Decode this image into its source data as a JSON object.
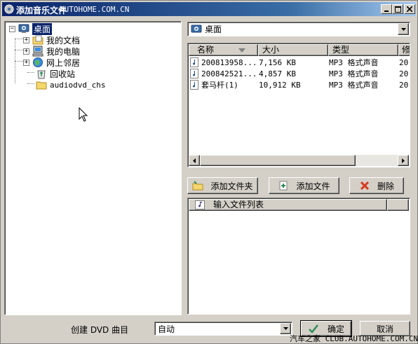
{
  "window": {
    "title": "添加音乐文件",
    "watermark": "AUTOHOME.COM.CN"
  },
  "tree": {
    "items": [
      {
        "label": "桌面",
        "icon": "desktop-icon",
        "expander": "−"
      },
      {
        "label": "我的文档",
        "icon": "my-documents-icon",
        "expander": "+"
      },
      {
        "label": "我的电脑",
        "icon": "my-computer-icon",
        "expander": "+"
      },
      {
        "label": "网上邻居",
        "icon": "network-icon",
        "expander": "+"
      },
      {
        "label": "回收站",
        "icon": "recycle-bin-icon"
      },
      {
        "label": "audiodvd_chs",
        "icon": "folder-icon"
      }
    ]
  },
  "location": {
    "value": "桌面"
  },
  "file_list": {
    "columns": [
      "名称",
      "大小",
      "类型",
      "修"
    ],
    "rows": [
      {
        "name": "200813958...",
        "size": "7,156 KB",
        "type": "MP3 格式声音",
        "extra": "20"
      },
      {
        "name": "200842521...",
        "size": "4,857 KB",
        "type": "MP3 格式声音",
        "extra": "20"
      },
      {
        "name": "套马杆(1)",
        "size": "10,912 KB",
        "type": "MP3 格式声音",
        "extra": "20"
      }
    ]
  },
  "actions": {
    "add_folder": "添加文件夹",
    "add_file": "添加文件",
    "delete": "删除"
  },
  "input_list": {
    "header": "输入文件列表"
  },
  "bottom": {
    "create_label": "创建 DVD 曲目",
    "mode_value": "自动",
    "ok": "确定",
    "cancel": "取消",
    "watermark": "汽车之家 CLUB.AUTOHOME.COM.CN"
  },
  "colors": {
    "selection": "#0a246a",
    "face": "#d4d0c8"
  }
}
